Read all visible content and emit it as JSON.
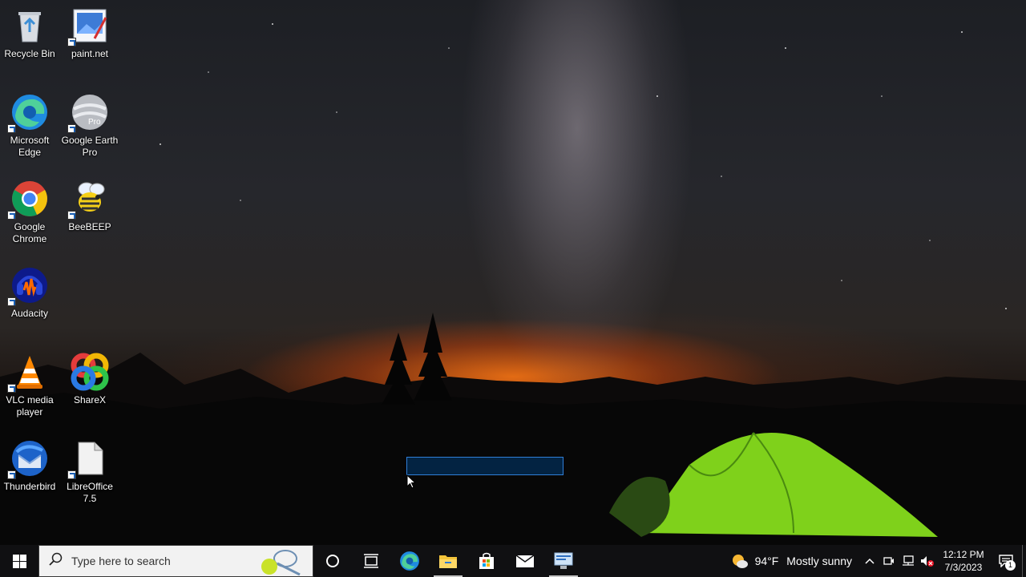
{
  "desktop": {
    "icons": [
      {
        "label": "Recycle Bin"
      },
      {
        "label": "paint.net"
      },
      {
        "label": "Microsoft Edge"
      },
      {
        "label": "Google Earth Pro",
        "badge": "Pro"
      },
      {
        "label": "Google Chrome"
      },
      {
        "label": "BeeBEEP"
      },
      {
        "label": "Audacity"
      },
      {
        "label": "VLC media player"
      },
      {
        "label": "ShareX"
      },
      {
        "label": "Thunderbird"
      },
      {
        "label": "LibreOffice 7.5"
      }
    ]
  },
  "taskbar": {
    "search_placeholder": "Type here to search",
    "pinned": [
      {
        "name": "cortana-icon"
      },
      {
        "name": "task-view-icon"
      },
      {
        "name": "edge-icon"
      },
      {
        "name": "file-explorer-icon"
      },
      {
        "name": "store-icon"
      },
      {
        "name": "mail-icon"
      },
      {
        "name": "remote-desktop-icon"
      }
    ],
    "weather": {
      "temp": "94°F",
      "condition": "Mostly sunny"
    },
    "clock": {
      "time": "12:12 PM",
      "date": "7/3/2023"
    },
    "notification_count": "1"
  },
  "colors": {
    "taskbar_bg": "#101012",
    "accent": "#2f7fd8",
    "tent": "#7fd11b"
  }
}
